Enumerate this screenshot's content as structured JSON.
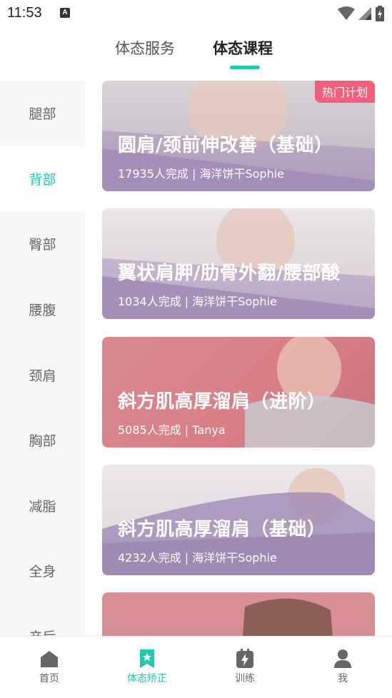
{
  "status_bar": {
    "time": "11:53",
    "badge": "A"
  },
  "top_tabs": {
    "tab1": "体态服务",
    "tab2": "体态课程"
  },
  "sidebar": {
    "items": [
      {
        "label": "腿部"
      },
      {
        "label": "背部"
      },
      {
        "label": "臀部"
      },
      {
        "label": "腰腹"
      },
      {
        "label": "颈肩"
      },
      {
        "label": "胸部"
      },
      {
        "label": "减脂"
      },
      {
        "label": "全身"
      },
      {
        "label": "产后"
      }
    ],
    "active_index": 1
  },
  "courses": [
    {
      "title": "圆肩/颈前伸改善（基础）",
      "subtitle": "17935人完成 | 海洋饼干Sophie",
      "badge": "热门计划"
    },
    {
      "title": "翼状肩胛/肋骨外翻/腰部酸",
      "subtitle": "1034人完成 | 海洋饼干Sophie"
    },
    {
      "title": "斜方肌高厚溜肩（进阶）",
      "subtitle": "5085人完成 | Tanya"
    },
    {
      "title": "斜方肌高厚溜肩（基础）",
      "subtitle": "4232人完成 | 海洋饼干Sophie"
    },
    {
      "title": "",
      "subtitle": ""
    }
  ],
  "bottom_nav": {
    "home": "首页",
    "posture": "体态矫正",
    "training": "训练",
    "me": "我"
  },
  "colors": {
    "accent": "#21c9ae",
    "badge": "#f0607a",
    "band_purple": "#9b86b3"
  }
}
